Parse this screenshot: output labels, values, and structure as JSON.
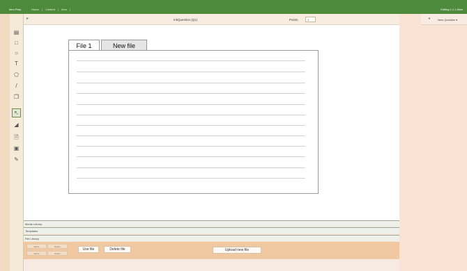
{
  "topbar": {
    "brand": "Item Prep",
    "breadcrumbs": [
      "Home",
      "|",
      "Content",
      "|",
      "Item",
      "|"
    ],
    "user": "Editing 1.1.1  Alice"
  },
  "toolbar": {
    "tools": [
      {
        "name": "select-image-icon",
        "glyph": "▤"
      },
      {
        "name": "rectangle-icon",
        "glyph": "□"
      },
      {
        "name": "ellipse-icon",
        "glyph": "○"
      },
      {
        "name": "text-icon",
        "glyph": "T"
      },
      {
        "name": "polygon-icon",
        "glyph": "⬠"
      },
      {
        "name": "line-icon",
        "glyph": "/"
      },
      {
        "name": "copy-icon",
        "glyph": "❐"
      },
      {
        "name": "pointer-icon",
        "glyph": "↖"
      },
      {
        "name": "resize-icon",
        "glyph": "◢"
      },
      {
        "name": "file-icon",
        "glyph": "🗎"
      },
      {
        "name": "paste-icon",
        "glyph": "▣"
      },
      {
        "name": "edit-image-icon",
        "glyph": "✎"
      }
    ]
  },
  "titlebar": {
    "title": "InkQuestion (Q1)",
    "points_label": "Points",
    "points_value": "1"
  },
  "right_panel": {
    "new_question": "New Question ▾"
  },
  "editor": {
    "tabs": [
      "File 1",
      "New file"
    ]
  },
  "libraries": {
    "media": "Media Library",
    "templates": "Templates",
    "files": "File Library"
  },
  "file_library": {
    "cells": [
      "Name",
      "Delete",
      "Name",
      "Delete"
    ],
    "use_file": "Use file",
    "delete_file": "Delete file",
    "upload": "Upload new file"
  }
}
